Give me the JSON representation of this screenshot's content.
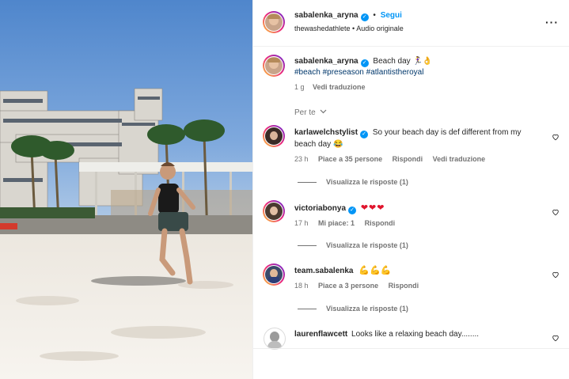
{
  "post": {
    "author": "sabalenka_aryna",
    "separator": "•",
    "follow_label": "Segui",
    "audio_credit": "thewashedathlete • Audio originale",
    "more_icon": "more-horizontal-icon",
    "caption_text": "Beach day",
    "caption_emoji": "🏃‍♀️👌",
    "hashtags": [
      "#beach",
      "#preseason",
      "#atlantistheroyal"
    ],
    "age": "1 g",
    "translate_label": "Vedi traduzione"
  },
  "sort": {
    "label": "Per te",
    "icon": "chevron-down-icon"
  },
  "comments": [
    {
      "user": "karlawelchstylist",
      "verified": true,
      "text": "So your beach day is def different from my beach day",
      "emoji": "😂",
      "age": "23 h",
      "likes": "Piace a 35 persone",
      "reply": "Rispondi",
      "translate": "Vedi traduzione",
      "view_replies": "Visualizza le risposte (1)"
    },
    {
      "user": "victoriabonya",
      "verified": true,
      "text": "",
      "emoji": "❤❤❤",
      "age": "17 h",
      "likes": "Mi piace: 1",
      "reply": "Rispondi",
      "view_replies": "Visualizza le risposte (1)"
    },
    {
      "user": "team.sabalenka",
      "verified": false,
      "text": "",
      "emoji": "💪💪💪",
      "age": "18 h",
      "likes": "Piace a 3 persone",
      "reply": "Rispondi",
      "view_replies": "Visualizza le risposte (1)"
    },
    {
      "user": "laurenflawcett",
      "verified": false,
      "text": "Looks like a relaxing beach day........"
    }
  ],
  "colors": {
    "link": "#0095f6",
    "hashtag": "#00376b",
    "muted": "#737373",
    "heart_red": "#e0152d"
  }
}
